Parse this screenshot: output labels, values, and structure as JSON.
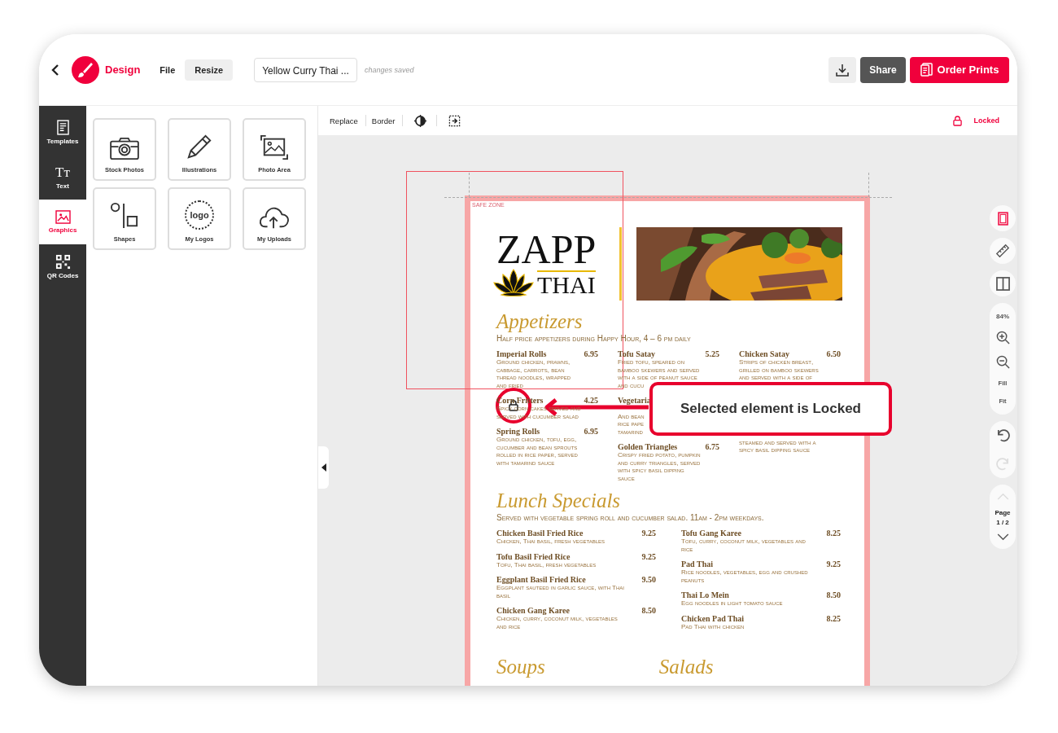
{
  "top_bar": {
    "app_name": "Design",
    "menu": [
      {
        "label": "File",
        "kind": "plain"
      },
      {
        "label": "Resize",
        "kind": "button"
      }
    ],
    "document_title": "Yellow Curry Thai ...",
    "save_status": "changes saved",
    "share": "Share",
    "order": "Order Prints"
  },
  "rail": [
    {
      "label": "Templates",
      "selected": false
    },
    {
      "label": "Text",
      "selected": false,
      "glyph": "Tт"
    },
    {
      "label": "Graphics",
      "selected": true
    },
    {
      "label": "QR Codes",
      "selected": false
    }
  ],
  "tiles": [
    {
      "label": "Stock Photos"
    },
    {
      "label": "Illustrations"
    },
    {
      "label": "Photo Area"
    },
    {
      "label": "Shapes"
    },
    {
      "label": "My Logos",
      "badge_text": "logo"
    },
    {
      "label": "My Uploads"
    }
  ],
  "canvas_toolbar": {
    "buttons": [
      "Replace",
      "Border"
    ],
    "lock_status": "Locked"
  },
  "menu_page": {
    "safe_zone_label": "SAFE ZONE",
    "logo_top": "ZAPP",
    "logo_bottom": "THAI",
    "sections": [
      {
        "title": "Appetizers",
        "subtitle": "Half price appetizers during Happy Hour, 4 – 6 pm daily",
        "columns": [
          [
            {
              "name": "Imperial Rolls",
              "price": "6.95",
              "desc": [
                "Ground chicken, prawns,",
                "cabbage, carrots, bean",
                "thread noodles, wrapped",
                "and fried"
              ]
            },
            {
              "name": "Corn Fritters",
              "price": "4.25",
              "desc": [
                "Spicy corn cakes served and",
                "served with cucumber salad"
              ]
            },
            {
              "name": "Spring Rolls",
              "price": "6.95",
              "desc": [
                "Ground chicken, tofu, egg,",
                "cucumber and bean sprouts",
                "rolled in rice paper, served",
                "with tamarind sauce"
              ]
            }
          ],
          [
            {
              "name": "Tofu Satay",
              "price": "5.25",
              "desc": [
                "Fried tofu, speared on",
                "bamboo skewers and served",
                "with a side of peanut sauce",
                "and cucu"
              ]
            },
            {
              "name": "Vegetaria",
              "kind": "partial",
              "desc": [
                "And bean",
                "rice pape",
                "tamarind"
              ]
            },
            {
              "name": "Golden Triangles",
              "price": "6.75",
              "desc": [
                "Crispy fried potato, pumpkin",
                "and curry triangles, served",
                "with spicy basil dipping",
                "sauce"
              ]
            }
          ],
          [
            {
              "name": "Chicken Satay",
              "price": "6.50",
              "desc": [
                "Strips of chicken breast,",
                "grilled on bamboo skewers",
                "and served with a side of"
              ]
            },
            {
              "kind": "partial",
              "desc": [
                "steamed and served with a",
                "spicy basil dipping sauce"
              ]
            }
          ]
        ]
      },
      {
        "title": "Lunch Specials",
        "subtitle": "Served with vegetable spring roll and cucumber salad. 11am - 2pm weekdays.",
        "columns": [
          [
            {
              "name": "Chicken Basil Fried Rice",
              "price": "9.25",
              "desc": [
                "Chicken, Thai basil, fresh vegetables"
              ]
            },
            {
              "name": "Tofu Basil Fried Rice",
              "price": "9.25",
              "desc": [
                "Tofu, Thai basil, fresh vegetables"
              ]
            },
            {
              "name": "Eggplant Basil Fried Rice",
              "price": "9.50",
              "desc": [
                "Eggplant sauteed in garlic sauce, with Thai",
                "basil"
              ]
            },
            {
              "name": "Chicken Gang Karee",
              "price": "8.50",
              "desc": [
                "Chicken, curry, coconut milk, vegetables",
                "and rice"
              ]
            }
          ],
          [
            {
              "name": "Tofu Gang Karee",
              "price": "8.25",
              "desc": [
                "Tofu, curry, coconut milk, vegetables and",
                "rice"
              ]
            },
            {
              "name": "Pad Thai",
              "price": "9.25",
              "desc": [
                "Rice noodles, vegetables, egg and crushed",
                "peanuts"
              ]
            },
            {
              "name": "Thai Lo Mein",
              "price": "8.50",
              "desc": [
                "Egg noodles in light tomato sauce"
              ]
            },
            {
              "name": "Chicken Pad Thai",
              "price": "8.25",
              "desc": [
                "Pad Thai with chicken"
              ]
            }
          ]
        ]
      }
    ],
    "section_pair": [
      {
        "title": "Soups"
      },
      {
        "title": "Salads"
      }
    ]
  },
  "callout": {
    "text": "Selected element is Locked"
  },
  "view_tools": {
    "zoom": "84%",
    "fill": "Fill",
    "fit": "Fit",
    "redo_disabled": true,
    "page_up_disabled": true,
    "page_label": "Page",
    "page_number": "1 / 2"
  }
}
